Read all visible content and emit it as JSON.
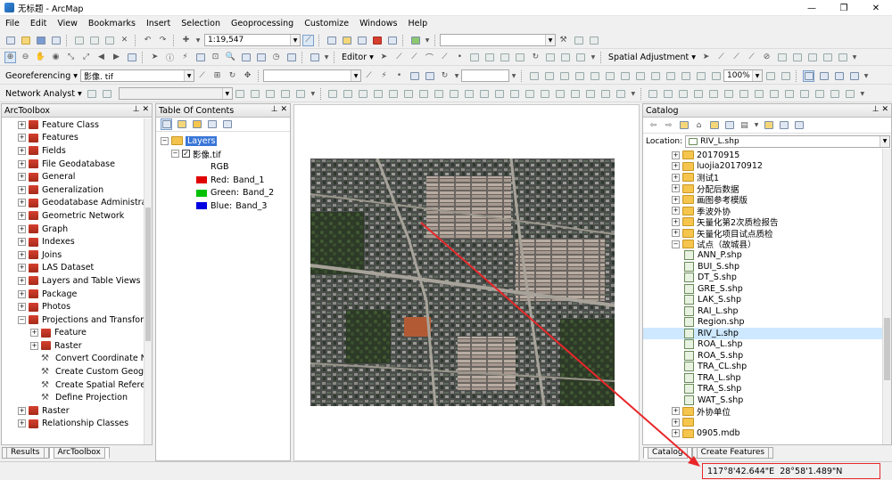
{
  "window": {
    "title": "无标题 - ArcMap"
  },
  "menu": [
    "File",
    "Edit",
    "View",
    "Bookmarks",
    "Insert",
    "Selection",
    "Geoprocessing",
    "Customize",
    "Windows",
    "Help"
  ],
  "toolbar1": {
    "scale": "1:19,547"
  },
  "toolbar3": {
    "editor": "Editor",
    "spatial_adjustment": "Spatial Adjustment",
    "zoom": "100%"
  },
  "toolbar4": {
    "georeferencing": "Georeferencing",
    "layer": "影像. tif"
  },
  "toolbar5": {
    "network_analyst": "Network Analyst"
  },
  "toolbox": {
    "title": "ArcToolbox",
    "items": [
      {
        "label": "Feature Class",
        "level": 1,
        "exp": "+",
        "icon": "toolbox"
      },
      {
        "label": "Features",
        "level": 1,
        "exp": "+",
        "icon": "toolbox"
      },
      {
        "label": "Fields",
        "level": 1,
        "exp": "+",
        "icon": "toolbox"
      },
      {
        "label": "File Geodatabase",
        "level": 1,
        "exp": "+",
        "icon": "toolbox"
      },
      {
        "label": "General",
        "level": 1,
        "exp": "+",
        "icon": "toolbox"
      },
      {
        "label": "Generalization",
        "level": 1,
        "exp": "+",
        "icon": "toolbox"
      },
      {
        "label": "Geodatabase Administrati",
        "level": 1,
        "exp": "+",
        "icon": "toolbox"
      },
      {
        "label": "Geometric Network",
        "level": 1,
        "exp": "+",
        "icon": "toolbox"
      },
      {
        "label": "Graph",
        "level": 1,
        "exp": "+",
        "icon": "toolbox"
      },
      {
        "label": "Indexes",
        "level": 1,
        "exp": "+",
        "icon": "toolbox"
      },
      {
        "label": "Joins",
        "level": 1,
        "exp": "+",
        "icon": "toolbox"
      },
      {
        "label": "LAS Dataset",
        "level": 1,
        "exp": "+",
        "icon": "toolbox"
      },
      {
        "label": "Layers and Table Views",
        "level": 1,
        "exp": "+",
        "icon": "toolbox"
      },
      {
        "label": "Package",
        "level": 1,
        "exp": "+",
        "icon": "toolbox"
      },
      {
        "label": "Photos",
        "level": 1,
        "exp": "+",
        "icon": "toolbox"
      },
      {
        "label": "Projections and Transform",
        "level": 1,
        "exp": "−",
        "icon": "toolbox"
      },
      {
        "label": "Feature",
        "level": 2,
        "exp": "+",
        "icon": "toolbox"
      },
      {
        "label": "Raster",
        "level": 2,
        "exp": "+",
        "icon": "toolbox"
      },
      {
        "label": "Convert Coordinate No",
        "level": 2,
        "exp": "",
        "icon": "tool"
      },
      {
        "label": "Create Custom Geogra",
        "level": 2,
        "exp": "",
        "icon": "tool"
      },
      {
        "label": "Create Spatial Referen",
        "level": 2,
        "exp": "",
        "icon": "tool"
      },
      {
        "label": "Define Projection",
        "level": 2,
        "exp": "",
        "icon": "tool"
      },
      {
        "label": "Raster",
        "level": 1,
        "exp": "+",
        "icon": "toolbox"
      },
      {
        "label": "Relationship Classes",
        "level": 1,
        "exp": "+",
        "icon": "toolbox"
      }
    ],
    "tabs": [
      "Results",
      "ArcToolbox"
    ]
  },
  "toc": {
    "title": "Table Of Contents",
    "layers_label": "Layers",
    "layer_name": "影像.tif",
    "rgb_label": "RGB",
    "bands": [
      {
        "name": "Red:",
        "band": "Band_1",
        "color": "#e00000"
      },
      {
        "name": "Green:",
        "band": "Band_2",
        "color": "#00c000"
      },
      {
        "name": "Blue:",
        "band": "Band_3",
        "color": "#0000e0"
      }
    ]
  },
  "catalog": {
    "title": "Catalog",
    "location_label": "Location:",
    "location_value": "RIV_L.shp",
    "items": [
      {
        "label": "20170915",
        "type": "folder",
        "level": 1,
        "exp": "+"
      },
      {
        "label": "luojia20170912",
        "type": "folder",
        "level": 1,
        "exp": "+"
      },
      {
        "label": "测试1",
        "type": "folder",
        "level": 1,
        "exp": "+"
      },
      {
        "label": "分配后数据",
        "type": "folder",
        "level": 1,
        "exp": "+"
      },
      {
        "label": "画图参考模版",
        "type": "folder",
        "level": 1,
        "exp": "+"
      },
      {
        "label": "季波外协",
        "type": "folder",
        "level": 1,
        "exp": "+"
      },
      {
        "label": "矢量化第2次质检报告",
        "type": "folder",
        "level": 1,
        "exp": "+"
      },
      {
        "label": "矢量化项目试点质检",
        "type": "folder",
        "level": 1,
        "exp": "+"
      },
      {
        "label": "试点（故城县）",
        "type": "folder",
        "level": 1,
        "exp": "−"
      },
      {
        "label": "ANN_P.shp",
        "type": "shp",
        "level": 2,
        "exp": ""
      },
      {
        "label": "BUI_S.shp",
        "type": "shp",
        "level": 2,
        "exp": ""
      },
      {
        "label": "DT_S.shp",
        "type": "shp",
        "level": 2,
        "exp": ""
      },
      {
        "label": "GRE_S.shp",
        "type": "shp",
        "level": 2,
        "exp": ""
      },
      {
        "label": "LAK_S.shp",
        "type": "shp",
        "level": 2,
        "exp": ""
      },
      {
        "label": "RAI_L.shp",
        "type": "shp",
        "level": 2,
        "exp": ""
      },
      {
        "label": "Region.shp",
        "type": "shp",
        "level": 2,
        "exp": ""
      },
      {
        "label": "RIV_L.shp",
        "type": "shp",
        "level": 2,
        "exp": ""
      },
      {
        "label": "ROA_L.shp",
        "type": "shp",
        "level": 2,
        "exp": ""
      },
      {
        "label": "ROA_S.shp",
        "type": "shp",
        "level": 2,
        "exp": ""
      },
      {
        "label": "TRA_CL.shp",
        "type": "shp",
        "level": 2,
        "exp": ""
      },
      {
        "label": "TRA_L.shp",
        "type": "shp",
        "level": 2,
        "exp": ""
      },
      {
        "label": "TRA_S.shp",
        "type": "shp",
        "level": 2,
        "exp": ""
      },
      {
        "label": "WAT_S.shp",
        "type": "shp",
        "level": 2,
        "exp": ""
      },
      {
        "label": "外协单位",
        "type": "folder",
        "level": 1,
        "exp": "+"
      },
      {
        "label": "",
        "type": "folder",
        "level": 1,
        "exp": "+"
      },
      {
        "label": "0905.mdb",
        "type": "folder",
        "level": 1,
        "exp": "+"
      }
    ],
    "tabs": [
      "Catalog",
      "Create Features"
    ]
  },
  "status": {
    "coords": "117°8'42.644\"E  28°58'1.489\"N"
  },
  "colors": {
    "selection": "#cde8ff",
    "annotation": "#e8272a"
  }
}
